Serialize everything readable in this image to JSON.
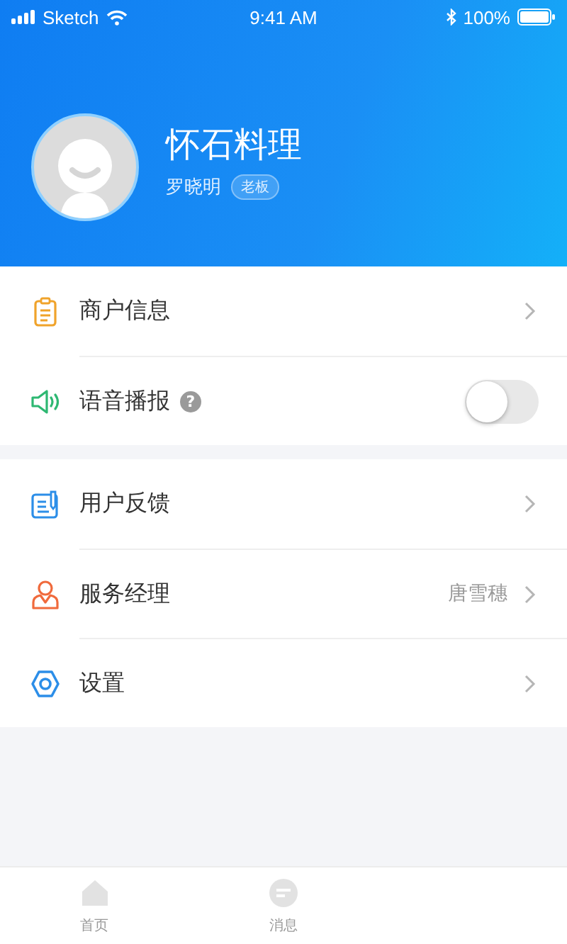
{
  "status_bar": {
    "carrier": "Sketch",
    "time": "9:41 AM",
    "battery": "100%"
  },
  "profile": {
    "shop_name": "怀石料理",
    "owner": "罗晓明",
    "role_badge": "老板"
  },
  "sections": [
    {
      "items": [
        {
          "kind": "link",
          "label": "商户信息"
        },
        {
          "kind": "toggle",
          "label": "语音播报",
          "help": "?",
          "on": false
        }
      ]
    },
    {
      "items": [
        {
          "kind": "link",
          "label": "用户反馈"
        },
        {
          "kind": "link",
          "label": "服务经理",
          "value": "唐雪穗"
        },
        {
          "kind": "link",
          "label": "设置"
        }
      ]
    }
  ],
  "tab_bar": [
    {
      "label": "首页",
      "selected": false
    },
    {
      "label": "消息",
      "selected": false
    }
  ]
}
